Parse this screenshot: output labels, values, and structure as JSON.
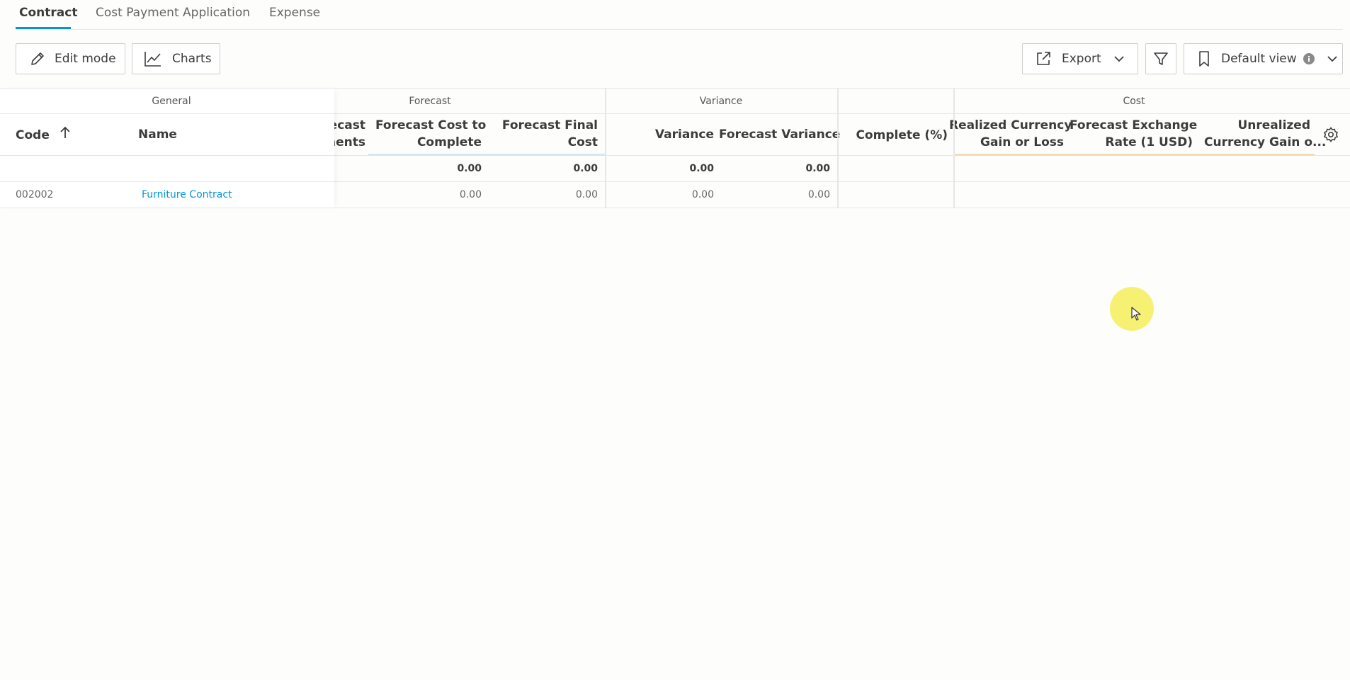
{
  "tabs": [
    {
      "label": "Contract",
      "active": true
    },
    {
      "label": "Cost Payment Application",
      "active": false
    },
    {
      "label": "Expense",
      "active": false
    }
  ],
  "toolbar": {
    "edit_mode_label": "Edit mode",
    "edit_mode_icon": "pencil-icon",
    "charts_label": "Charts",
    "charts_icon": "line-chart-icon",
    "export_label": "Export",
    "export_icon": "share-export-icon",
    "filter_icon": "funnel-icon",
    "view_label": "Default view",
    "view_icon": "bookmark-icon",
    "info_icon": "info-icon",
    "accent_color": "#0696d7"
  },
  "table": {
    "groups": {
      "general": "General",
      "forecast": "Forecast",
      "variance": "Variance",
      "cost": "Cost"
    },
    "columns": {
      "code": "Code",
      "name": "Name",
      "forecast_adjustments_1": "ecast",
      "forecast_adjustments_2": "nents",
      "forecast_cost_to_complete_1": "Forecast Cost to",
      "forecast_cost_to_complete_2": "Complete",
      "forecast_final_cost_1": "Forecast Final",
      "forecast_final_cost_2": "Cost",
      "variance": "Variance",
      "forecast_variance": "Forecast Variance",
      "complete_pct": "Complete (%)",
      "realized_currency_1": "Realized Currency",
      "realized_currency_2": "Gain or Loss",
      "forecast_exchange_1": "Forecast Exchange",
      "forecast_exchange_2": "Rate (1 USD)",
      "unrealized_currency_1": "Unrealized",
      "unrealized_currency_2": "Currency Gain o..."
    },
    "sort": {
      "column": "Code",
      "direction": "ascending"
    },
    "summary": {
      "forecast_cost_to_complete": "0.00",
      "forecast_final_cost": "0.00",
      "variance": "0.00",
      "forecast_variance": "0.00"
    },
    "rows": [
      {
        "code": "002002",
        "name": "Furniture Contract",
        "forecast_cost_to_complete": "0.00",
        "forecast_final_cost": "0.00",
        "variance": "0.00",
        "forecast_variance": "0.00"
      }
    ],
    "link_color": "#0696d7"
  }
}
